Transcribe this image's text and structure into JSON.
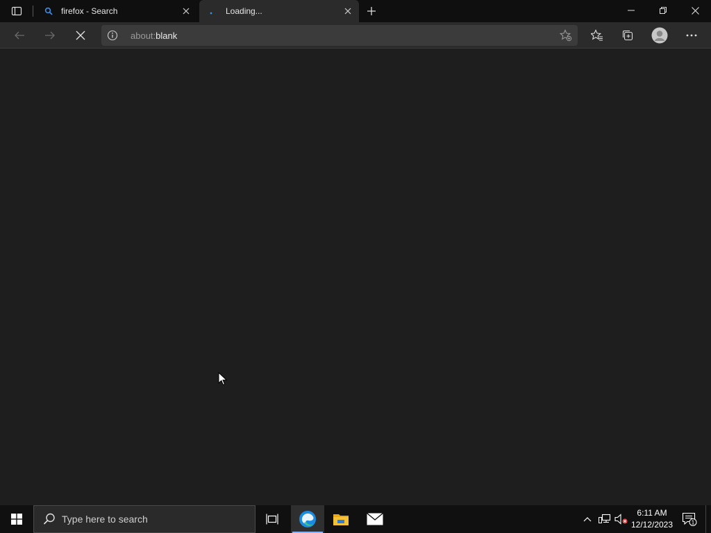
{
  "browser": {
    "tabs": [
      {
        "title": "firefox - Search",
        "active": false
      },
      {
        "title": "Loading...",
        "active": true
      }
    ],
    "address": {
      "scheme": "about:",
      "host": "blank"
    }
  },
  "taskbar": {
    "search_placeholder": "Type here to search",
    "clock": {
      "time": "6:11 AM",
      "date": "12/12/2023"
    },
    "notification_count": "1"
  },
  "colors": {
    "accent": "#8ab4f8",
    "content_bg": "#1e1e1e",
    "edge_blue": "#1b8be0",
    "folder_yellow": "#f3c13a"
  }
}
